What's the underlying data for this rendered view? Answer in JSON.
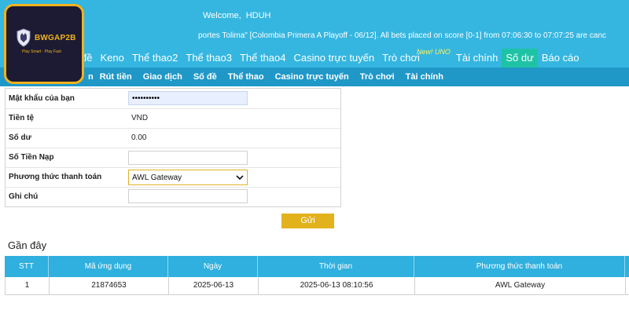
{
  "header": {
    "welcome_label": "Welcome,",
    "username": "HDUH",
    "ticker": "portes Tolima\" [Colombia Primera A Playoff - 06/12]. All bets placed on score [0-1] from 07:06:30 to 07:07:25 are canc",
    "logo": {
      "brand_text": "BWGAP2B",
      "tagline": "Play Smart · Play Fast"
    }
  },
  "nav_main": [
    {
      "label": "đề",
      "active": false
    },
    {
      "label": "Keno",
      "active": false
    },
    {
      "label": "Thể thao2",
      "active": false
    },
    {
      "label": "Thể thao3",
      "active": false
    },
    {
      "label": "Thể thao4",
      "active": false
    },
    {
      "label": "Casino trực tuyến",
      "active": false
    },
    {
      "label": "Trò chơi",
      "active": false,
      "badge": "New! UNO"
    },
    {
      "label": "Tài chính",
      "active": false
    },
    {
      "label": "Số dư",
      "active": true
    },
    {
      "label": "Báo cáo",
      "active": false
    }
  ],
  "nav_sub": [
    {
      "label": "n"
    },
    {
      "label": "Rút tiền"
    },
    {
      "label": "Giao dịch"
    },
    {
      "label": "Số đề"
    },
    {
      "label": "Thể thao"
    },
    {
      "label": "Casino trực tuyến"
    },
    {
      "label": "Trò chơi"
    },
    {
      "label": "Tài chính"
    }
  ],
  "form": {
    "password_label": "Mật khẩu của bạn",
    "password_value": "••••••••••",
    "currency_label": "Tiền tệ",
    "currency_value": "VND",
    "balance_label": "Số dư",
    "balance_value": "0.00",
    "deposit_label": "Số Tiền Nạp",
    "deposit_value": "",
    "payment_label": "Phương thức thanh toán",
    "payment_value": "AWL Gateway",
    "note_label": "Ghi chú",
    "note_value": "",
    "submit_label": "Gửi"
  },
  "recent": {
    "title": "Gần đây",
    "columns": [
      "STT",
      "Mã ứng dụng",
      "Ngày",
      "Thời gian",
      "Phương thức thanh toán"
    ],
    "rows": [
      [
        "1",
        "21874653",
        "2025-06-13",
        "2025-06-13 08:10:56",
        "AWL Gateway"
      ]
    ]
  },
  "colors": {
    "header_bg": "#34b6e0",
    "subnav_bg": "#1f98c8",
    "active_tab": "#1ec3a5",
    "submit_bg": "#e2b21c",
    "table_header": "#2fb0de",
    "logo_gold": "#f2b21c"
  },
  "icons": {
    "logo_icon": "wolf-shield-icon",
    "select_icon": "chevron-down-icon"
  }
}
